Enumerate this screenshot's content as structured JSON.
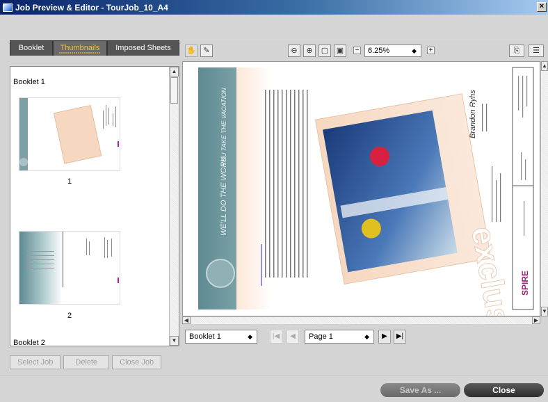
{
  "window": {
    "title": "Job Preview & Editor - TourJob_10_A4",
    "close_label": "×"
  },
  "tabs": [
    {
      "label": "Booklet"
    },
    {
      "label": "Thumbnails"
    },
    {
      "label": "Imposed Sheets"
    }
  ],
  "thumbnails": {
    "booklets": [
      {
        "label": "Booklet 1",
        "pages": [
          "1",
          "2"
        ]
      },
      {
        "label": "Booklet 2"
      }
    ]
  },
  "left_buttons": {
    "select_job": "Select Job",
    "delete": "Delete",
    "close_job": "Close Job"
  },
  "toolbar": {
    "zoom_value": "6.25%",
    "minus": "−",
    "plus": "+"
  },
  "preview": {
    "vertical_top": "YOU TAKE THE VACATION",
    "vertical_bottom": "WE'LL DO THE WORK",
    "headline": "exclusive",
    "brand": "SPIRE",
    "signature": "Brandon Ryhs"
  },
  "navigation": {
    "booklet_select": "Booklet 1",
    "page_select": "Page 1"
  },
  "bottom_buttons": {
    "save_as": "Save As ...",
    "close": "Close"
  }
}
